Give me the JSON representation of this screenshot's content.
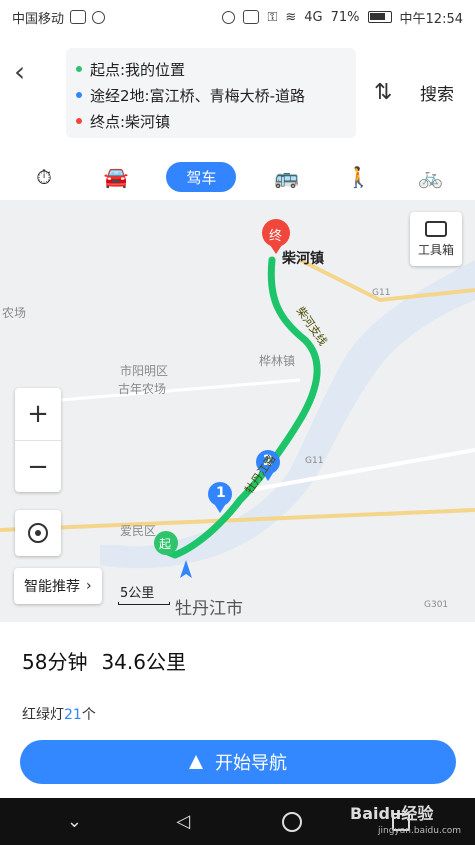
{
  "status_bar": {
    "carrier": "中国移动",
    "battery": "71%",
    "time": "中午12:54",
    "signal": "4G"
  },
  "header": {
    "back_icon": "back-arrow-icon",
    "start_label": "起点:我的位置",
    "via_label": "途经2地:富江桥、青梅大桥-道路",
    "end_label": "终点:柴河镇",
    "swap_icon": "swap-icon",
    "search_label": "搜索"
  },
  "colors": {
    "start_dot": "#2fc46c",
    "via_dot": "#3385ff",
    "end_dot": "#f0463b",
    "route": "#1ec46a",
    "accent": "#3385ff"
  },
  "tabs": [
    {
      "id": "taxi",
      "icon": "stopwatch-icon",
      "label": ""
    },
    {
      "id": "carpool",
      "icon": "car-people-icon",
      "label": ""
    },
    {
      "id": "drive",
      "icon": "",
      "label": "驾车",
      "active": true
    },
    {
      "id": "bus",
      "icon": "bus-icon",
      "label": ""
    },
    {
      "id": "walk",
      "icon": "walk-icon",
      "label": ""
    },
    {
      "id": "bike",
      "icon": "bicycle-icon",
      "label": ""
    }
  ],
  "map": {
    "toolbox_label": "工具箱",
    "dest_marker": "终",
    "dest_name": "柴河镇",
    "start_marker": "起",
    "waypoint_1": "1",
    "waypoint_2": "2",
    "road_label_1": "柴河支线",
    "road_label_2": "G11",
    "road_label_3": "G11",
    "road_label_4": "G301",
    "road_label_5": "牡丹江路",
    "area_1": "市阳明区",
    "area_2": "古年农场",
    "area_3": "桦林镇",
    "area_4": "农场",
    "area_5": "爱民区",
    "zoom_in": "+",
    "zoom_out": "−",
    "smart_label": "智能推荐",
    "scale_label": "5公里",
    "city_label": "牡丹江市"
  },
  "summary": {
    "time": "58分钟",
    "distance": "34.6公里",
    "lights_prefix": "红绿灯",
    "lights_count": "21",
    "lights_suffix": "个"
  },
  "start_button": "开始导航",
  "watermark": {
    "brand": "Baidu经验",
    "url": "jingyan.baidu.com"
  }
}
